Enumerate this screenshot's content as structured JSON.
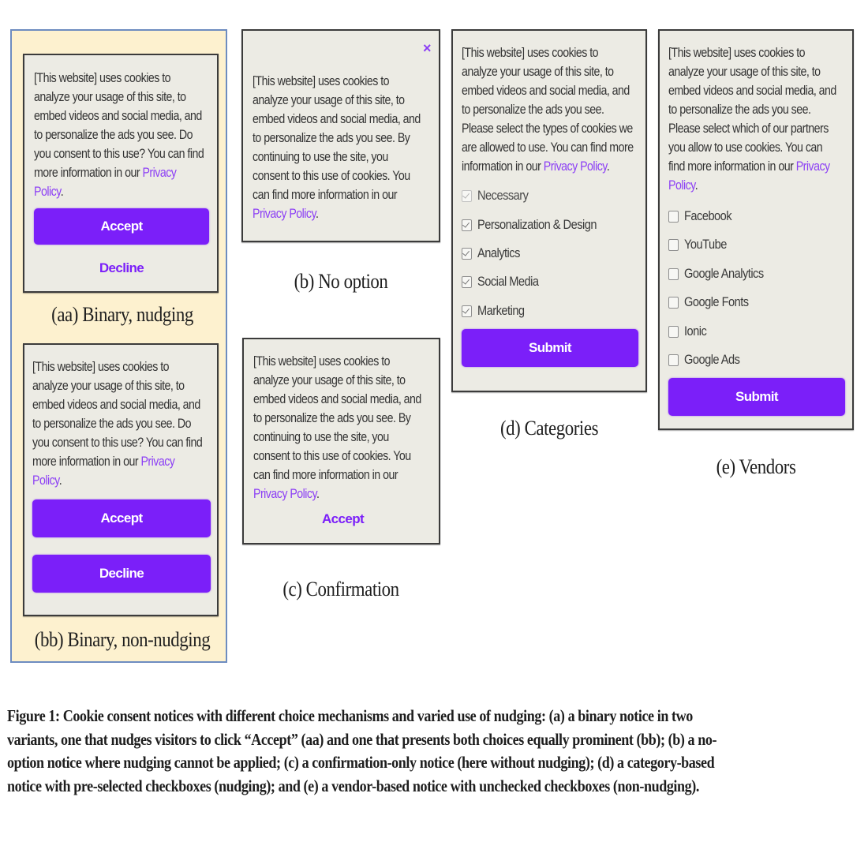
{
  "figure": {
    "caption_lines": [
      "Figure 1: Cookie consent notices with different choice mechanisms and varied use of nudging: (a) a binary notice in two",
      "variants, one that nudges visitors to click “Accept” (aa) and one that presents both choices equally prominent (bb); (b) a no-",
      "option notice where nudging cannot be applied; (c) a confirmation-only notice (here without nudging); (d) a category-based",
      "notice with pre-selected checkboxes (nudging); and (e) a vendor-based notice with unchecked checkboxes (non-nudging)."
    ]
  },
  "colors": {
    "accent_purple": "#7b1ff9",
    "link_purple": "#8c3ff5",
    "notice_bg": "#ecebe4",
    "highlight_bg": "#fdf1cf",
    "highlight_border": "#6d8cc0"
  },
  "privacy_link": "Privacy Policy",
  "panels": {
    "aa": {
      "label": "(aa) Binary, nudging",
      "text_lines": [
        "[This website] uses cookies to",
        "analyze your usage of this site, to",
        "embed videos and social media, and",
        "to personalize the ads you see. Do",
        "you consent to this use? You can find",
        "more information in our "
      ],
      "link_first": "Privacy",
      "link_second": "Policy",
      "accept": "Accept",
      "decline": "Decline"
    },
    "bb": {
      "label": "(bb) Binary, non-nudging",
      "text_lines": [
        "[This website] uses cookies to",
        "analyze your usage of this site, to",
        "embed videos and social media, and",
        "to personalize the ads you see. Do",
        "you consent to this use? You can find",
        "more information in our "
      ],
      "link_first": "Privacy",
      "link_second": "Policy",
      "accept": "Accept",
      "decline": "Decline"
    },
    "b": {
      "label": "(b) No option",
      "close_icon": "×",
      "text_lines": [
        "[This website] uses cookies to",
        "analyze your usage of this site, to",
        "embed videos and social media, and",
        "to personalize the ads you see. By",
        "continuing to use the site, you",
        "consent to this use of cookies. You",
        "can find more information in our"
      ],
      "link": "Privacy Policy"
    },
    "c": {
      "label": "(c) Confirmation",
      "text_lines": [
        "[This website] uses cookies to",
        "analyze your usage of this site, to",
        "embed videos and social media, and",
        "to personalize the ads you see. By",
        "continuing to use the site, you",
        "consent to this use of cookies. You",
        "can find more information in our"
      ],
      "link": "Privacy Policy",
      "accept": "Accept"
    },
    "d": {
      "label": "(d) Categories",
      "text_lines": [
        "[This website] uses cookies to",
        "analyze your usage of this site, to",
        "embed videos and social media, and",
        "to personalize the ads you see.",
        "Please select the types of cookies we",
        "are allowed to use. You can find more",
        "information in our "
      ],
      "link": "Privacy Policy",
      "options": [
        {
          "label": "Necessary",
          "checked": true,
          "disabled": true
        },
        {
          "label": "Personalization & Design",
          "checked": true,
          "disabled": false
        },
        {
          "label": "Analytics",
          "checked": true,
          "disabled": false
        },
        {
          "label": "Social Media",
          "checked": true,
          "disabled": false
        },
        {
          "label": "Marketing",
          "checked": true,
          "disabled": false
        }
      ],
      "submit": "Submit"
    },
    "e": {
      "label": "(e) Vendors",
      "text_lines": [
        "[This website] uses cookies to",
        "analyze your usage of this site, to",
        "embed videos and social media, and",
        "to personalize the ads you see.",
        "Please select which of our partners",
        "you allow to use cookies. You can",
        "find more information in our "
      ],
      "link_first": "Privacy",
      "link_second": "Policy",
      "options": [
        {
          "label": "Facebook",
          "checked": false
        },
        {
          "label": "YouTube",
          "checked": false
        },
        {
          "label": "Google Analytics",
          "checked": false
        },
        {
          "label": "Google Fonts",
          "checked": false
        },
        {
          "label": "Ionic",
          "checked": false
        },
        {
          "label": "Google Ads",
          "checked": false
        }
      ],
      "submit": "Submit"
    }
  }
}
